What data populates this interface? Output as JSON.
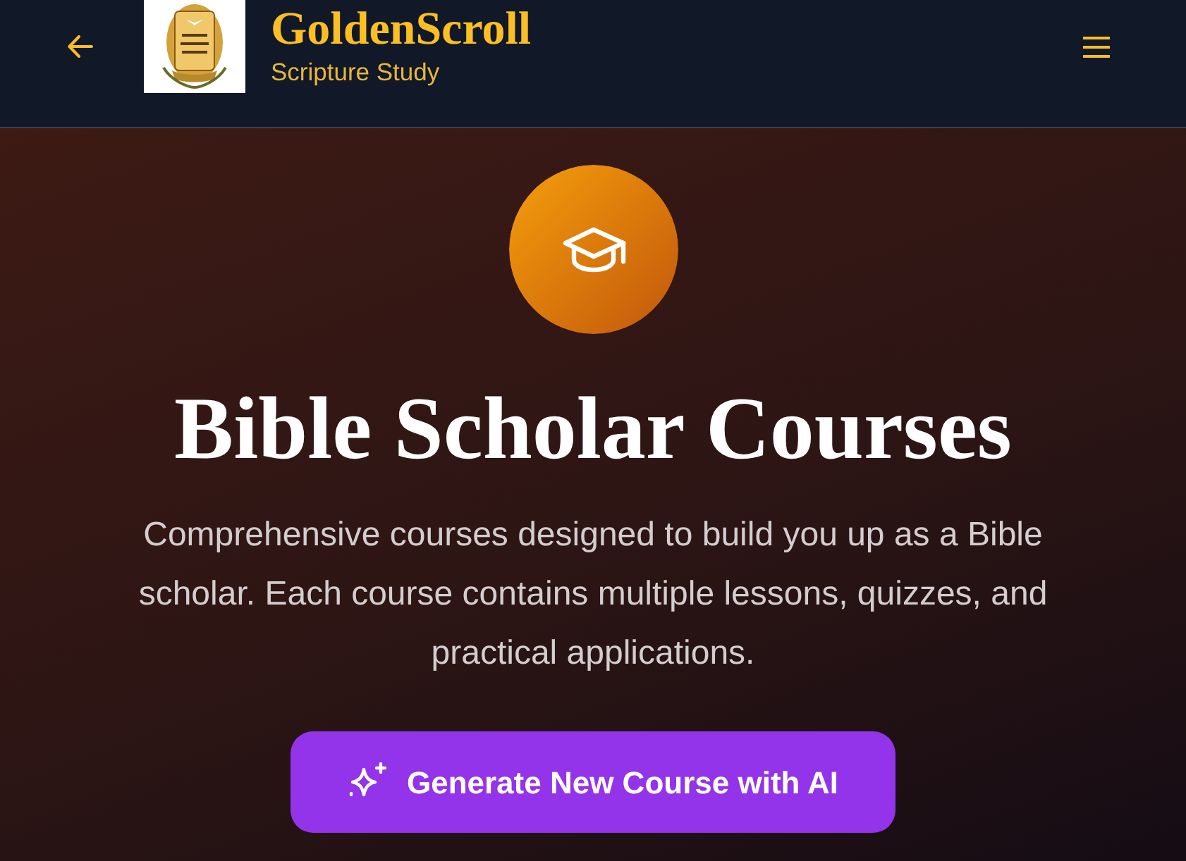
{
  "header": {
    "brand": {
      "title": "GoldenScroll",
      "subtitle": "Scripture Study"
    }
  },
  "hero": {
    "title": "Bible Scholar Courses",
    "description": "Comprehensive courses designed to build you up as a Bible scholar. Each course contains multiple lessons, quizzes, and practical applications.",
    "button": {
      "label": "Generate New Course with AI"
    }
  }
}
